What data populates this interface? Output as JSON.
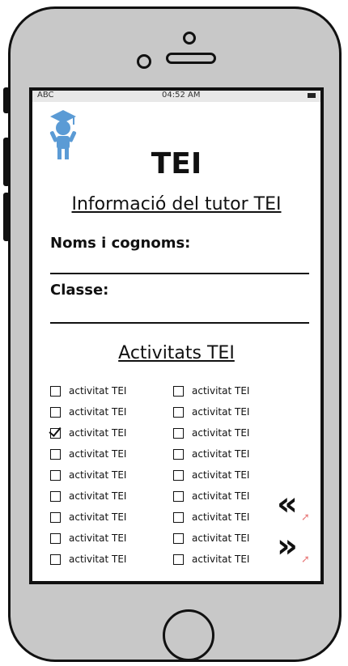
{
  "status": {
    "carrier": "ABC",
    "time": "04:52 AM"
  },
  "page": {
    "title": "TEI",
    "subtitle": "Informació del tutor TEI",
    "name_label": "Noms i cognoms:",
    "class_label": "Classe:",
    "activities_title": "Activitats TEI"
  },
  "activities": {
    "left": [
      {
        "label": "activitat TEI",
        "checked": false
      },
      {
        "label": "activitat TEI",
        "checked": false
      },
      {
        "label": "activitat TEI",
        "checked": true
      },
      {
        "label": "activitat TEI",
        "checked": false
      },
      {
        "label": "activitat TEI",
        "checked": false
      },
      {
        "label": "activitat TEI",
        "checked": false
      },
      {
        "label": "activitat TEI",
        "checked": false
      },
      {
        "label": "activitat TEI",
        "checked": false
      },
      {
        "label": "activitat TEI",
        "checked": false
      }
    ],
    "right": [
      {
        "label": "activitat TEI",
        "checked": false
      },
      {
        "label": "activitat TEI",
        "checked": false
      },
      {
        "label": "activitat TEI",
        "checked": false
      },
      {
        "label": "activitat TEI",
        "checked": false
      },
      {
        "label": "activitat TEI",
        "checked": false
      },
      {
        "label": "activitat TEI",
        "checked": false
      },
      {
        "label": "activitat TEI",
        "checked": false
      },
      {
        "label": "activitat TEI",
        "checked": false
      },
      {
        "label": "activitat TEI",
        "checked": false
      }
    ]
  },
  "nav": {
    "prev_glyph": "«",
    "next_glyph": "»",
    "accent": "#e98080"
  },
  "icons": {
    "logo": "graduate-icon"
  }
}
